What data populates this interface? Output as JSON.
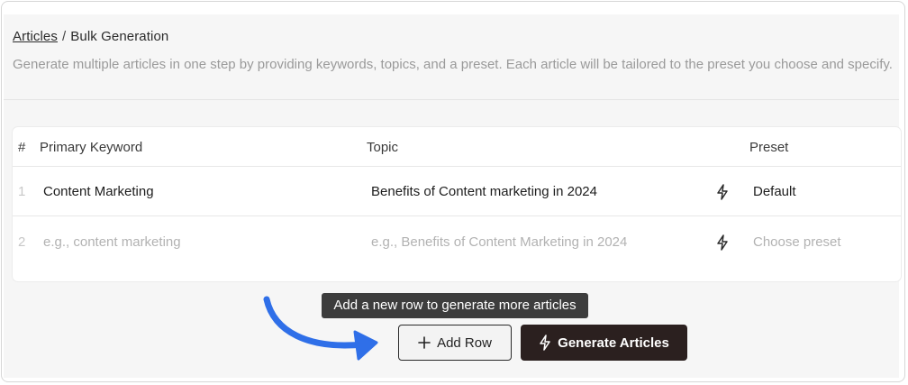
{
  "breadcrumb": {
    "parent": "Articles",
    "separator": "/",
    "current": "Bulk Generation"
  },
  "description": "Generate multiple articles in one step by providing keywords, topics, and a preset. Each article will be tailored to the preset you choose and specify.",
  "table": {
    "headers": {
      "index": "#",
      "keyword": "Primary Keyword",
      "topic": "Topic",
      "preset": "Preset"
    },
    "rows": [
      {
        "index": "1",
        "keyword": "Content Marketing",
        "topic": "Benefits of Content marketing in 2024",
        "preset": "Default"
      },
      {
        "index": "2",
        "keyword_placeholder": "e.g., content marketing",
        "topic_placeholder": "e.g., Benefits of Content Marketing in 2024",
        "preset_placeholder": "Choose preset"
      }
    ]
  },
  "tooltip": "Add a new row to generate more articles",
  "buttons": {
    "add_row": "Add Row",
    "generate": "Generate Articles"
  },
  "colors": {
    "primary_button": "#2b201f",
    "annotation_arrow": "#2f6fe8",
    "tooltip_bg": "#3d3d3d"
  },
  "icons": [
    "bolt-icon",
    "plus-icon",
    "arrow-annotation"
  ]
}
